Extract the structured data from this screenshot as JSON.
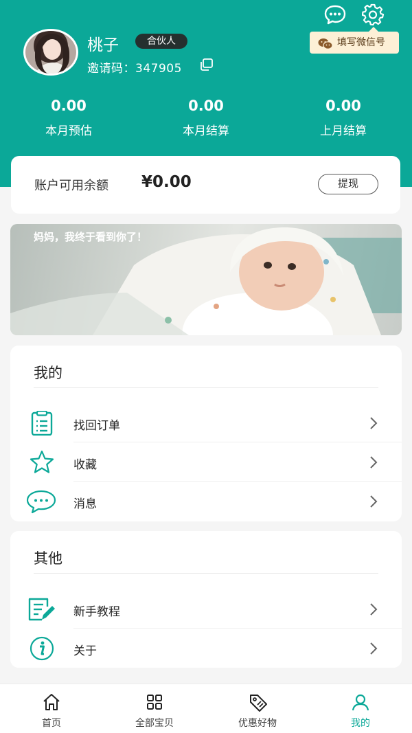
{
  "colors": {
    "primary": "#0ba898",
    "badge_bg": "#25302f",
    "tip_bg": "#fdf0d6"
  },
  "header": {
    "username": "桃子",
    "badge": "合伙人",
    "invite_text": "邀请码：347905",
    "wechat_tip": "填写微信号",
    "stats": [
      {
        "value": "0.00",
        "label": "本月预估"
      },
      {
        "value": "0.00",
        "label": "本月结算"
      },
      {
        "value": "0.00",
        "label": "上月结算"
      }
    ]
  },
  "balance": {
    "label": "账户可用余额",
    "amount": "¥0.00",
    "button": "提现"
  },
  "banner": {
    "text": "妈妈，我终于看到你了！"
  },
  "mine": {
    "title": "我的",
    "items": [
      {
        "label": "找回订单",
        "icon": "clipboard-icon"
      },
      {
        "label": "收藏",
        "icon": "star-icon"
      },
      {
        "label": "消息",
        "icon": "chat-bubble-icon"
      }
    ]
  },
  "other": {
    "title": "其他",
    "items": [
      {
        "label": "新手教程",
        "icon": "edit-note-icon"
      },
      {
        "label": "关于",
        "icon": "info-icon"
      }
    ]
  },
  "tabbar": {
    "items": [
      {
        "label": "首页",
        "icon": "home-icon"
      },
      {
        "label": "全部宝贝",
        "icon": "grid-icon"
      },
      {
        "label": "优惠好物",
        "icon": "tag-icon"
      },
      {
        "label": "我的",
        "icon": "user-icon",
        "active": true
      }
    ]
  }
}
